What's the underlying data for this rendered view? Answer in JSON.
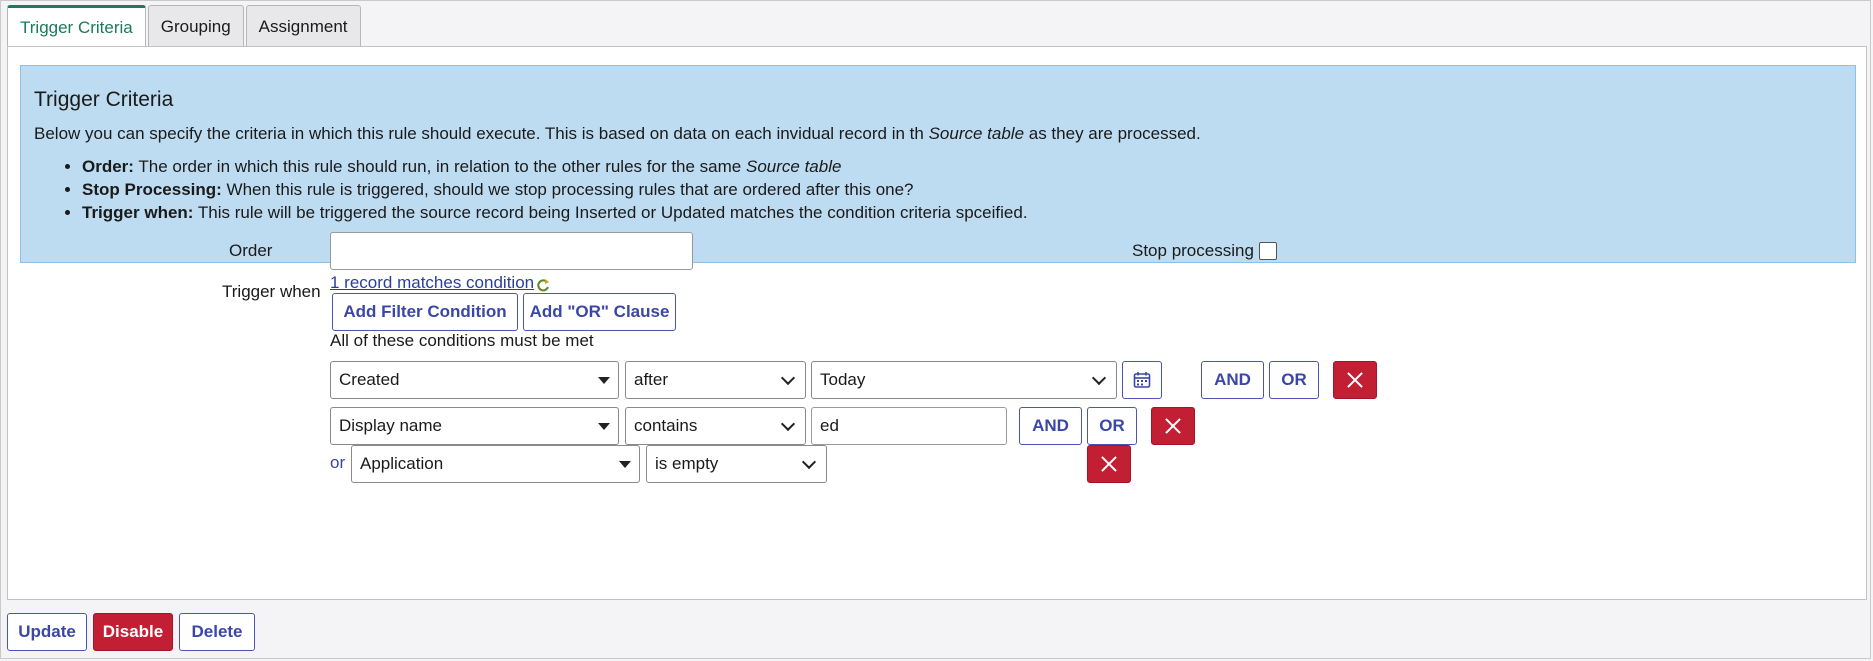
{
  "tabs": [
    {
      "label": "Trigger Criteria"
    },
    {
      "label": "Grouping"
    },
    {
      "label": "Assignment"
    }
  ],
  "info": {
    "title": "Trigger Criteria",
    "intro_pre": "Below you can specify the criteria in which this rule should execute. This is based on data on each invidual record in th ",
    "intro_em": "Source table",
    "intro_post": " as they are processed.",
    "bullets": [
      {
        "term": "Order:",
        "text": " The order in which this rule should run, in relation to the other rules for the same ",
        "em": "Source table"
      },
      {
        "term": "Stop Processing:",
        "text": " When this rule is triggered, should we stop processing rules that are ordered after this one?",
        "em": ""
      },
      {
        "term": "Trigger when:",
        "text": " This rule will be triggered the source record being Inserted or Updated matches the condition criteria spceified.",
        "em": ""
      }
    ]
  },
  "form": {
    "order_label": "Order",
    "order_value": "",
    "stop_label": "Stop processing",
    "trigger_label": "Trigger when",
    "match_link": "1 record matches condition",
    "add_filter": "Add Filter Condition",
    "add_or": "Add \"OR\" Clause",
    "all_met": "All of these conditions must be met"
  },
  "conditions": [
    {
      "field": "Created",
      "operator": "after",
      "value": "Today",
      "and": "AND",
      "or": "OR"
    },
    {
      "field": "Display name",
      "operator": "contains",
      "value": "ed",
      "and": "AND",
      "or": "OR"
    },
    {
      "prefix": "or",
      "field": "Application",
      "operator": "is empty"
    }
  ],
  "actions": {
    "update": "Update",
    "disable": "Disable",
    "delete": "Delete"
  }
}
